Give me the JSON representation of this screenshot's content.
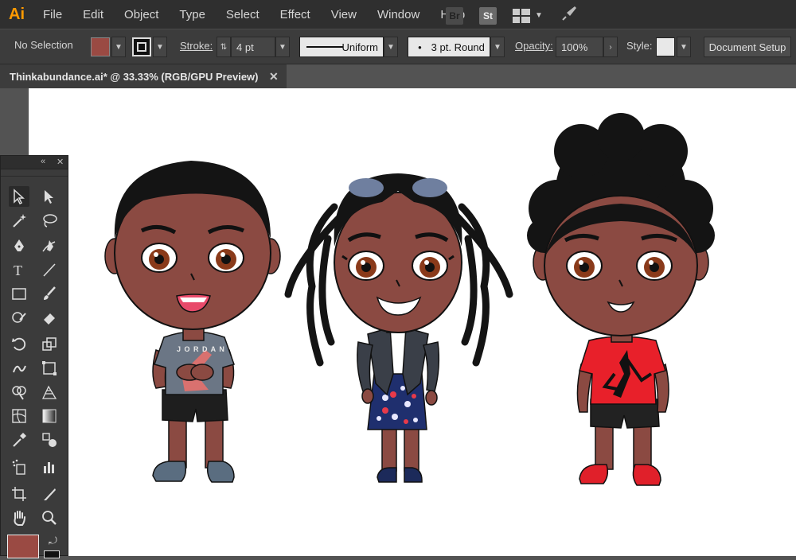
{
  "app": {
    "logo_text": "Ai",
    "logo_color": "#ff9a00"
  },
  "menu": [
    "File",
    "Edit",
    "Object",
    "Type",
    "Select",
    "Effect",
    "View",
    "Window",
    "Help"
  ],
  "menu_right": {
    "bridge": "Br",
    "stock": "St"
  },
  "control": {
    "selection": "No Selection",
    "fill_color": "#9a4a43",
    "stroke_label": "Stroke:",
    "stroke_weight": "4 pt",
    "stroke_profile": "Uniform",
    "brush": "3 pt. Round",
    "opacity_label": "Opacity:",
    "opacity_value": "100%",
    "style_label": "Style:",
    "doc_setup": "Document Setup"
  },
  "document": {
    "tab_title": "Thinkabundance.ai* @ 33.33% (RGB/GPU Preview)"
  },
  "tools": [
    "selection-tool",
    "direct-selection-tool",
    "magic-wand-tool",
    "lasso-tool",
    "pen-tool",
    "curvature-tool",
    "type-tool",
    "line-tool",
    "rectangle-tool",
    "paintbrush-tool",
    "shaper-tool",
    "eraser-tool",
    "rotate-tool",
    "scale-tool",
    "warp-tool",
    "free-transform-tool",
    "shape-builder-tool",
    "perspective-grid-tool",
    "mesh-tool",
    "gradient-tool",
    "eyedropper-tool",
    "blend-tool",
    "symbol-sprayer-tool",
    "column-graph-tool",
    "artboard-tool",
    "slice-tool",
    "hand-tool",
    "zoom-tool"
  ],
  "colors": {
    "skin": "#8b4a42",
    "hair": "#141414",
    "canvas": "#ffffff"
  }
}
